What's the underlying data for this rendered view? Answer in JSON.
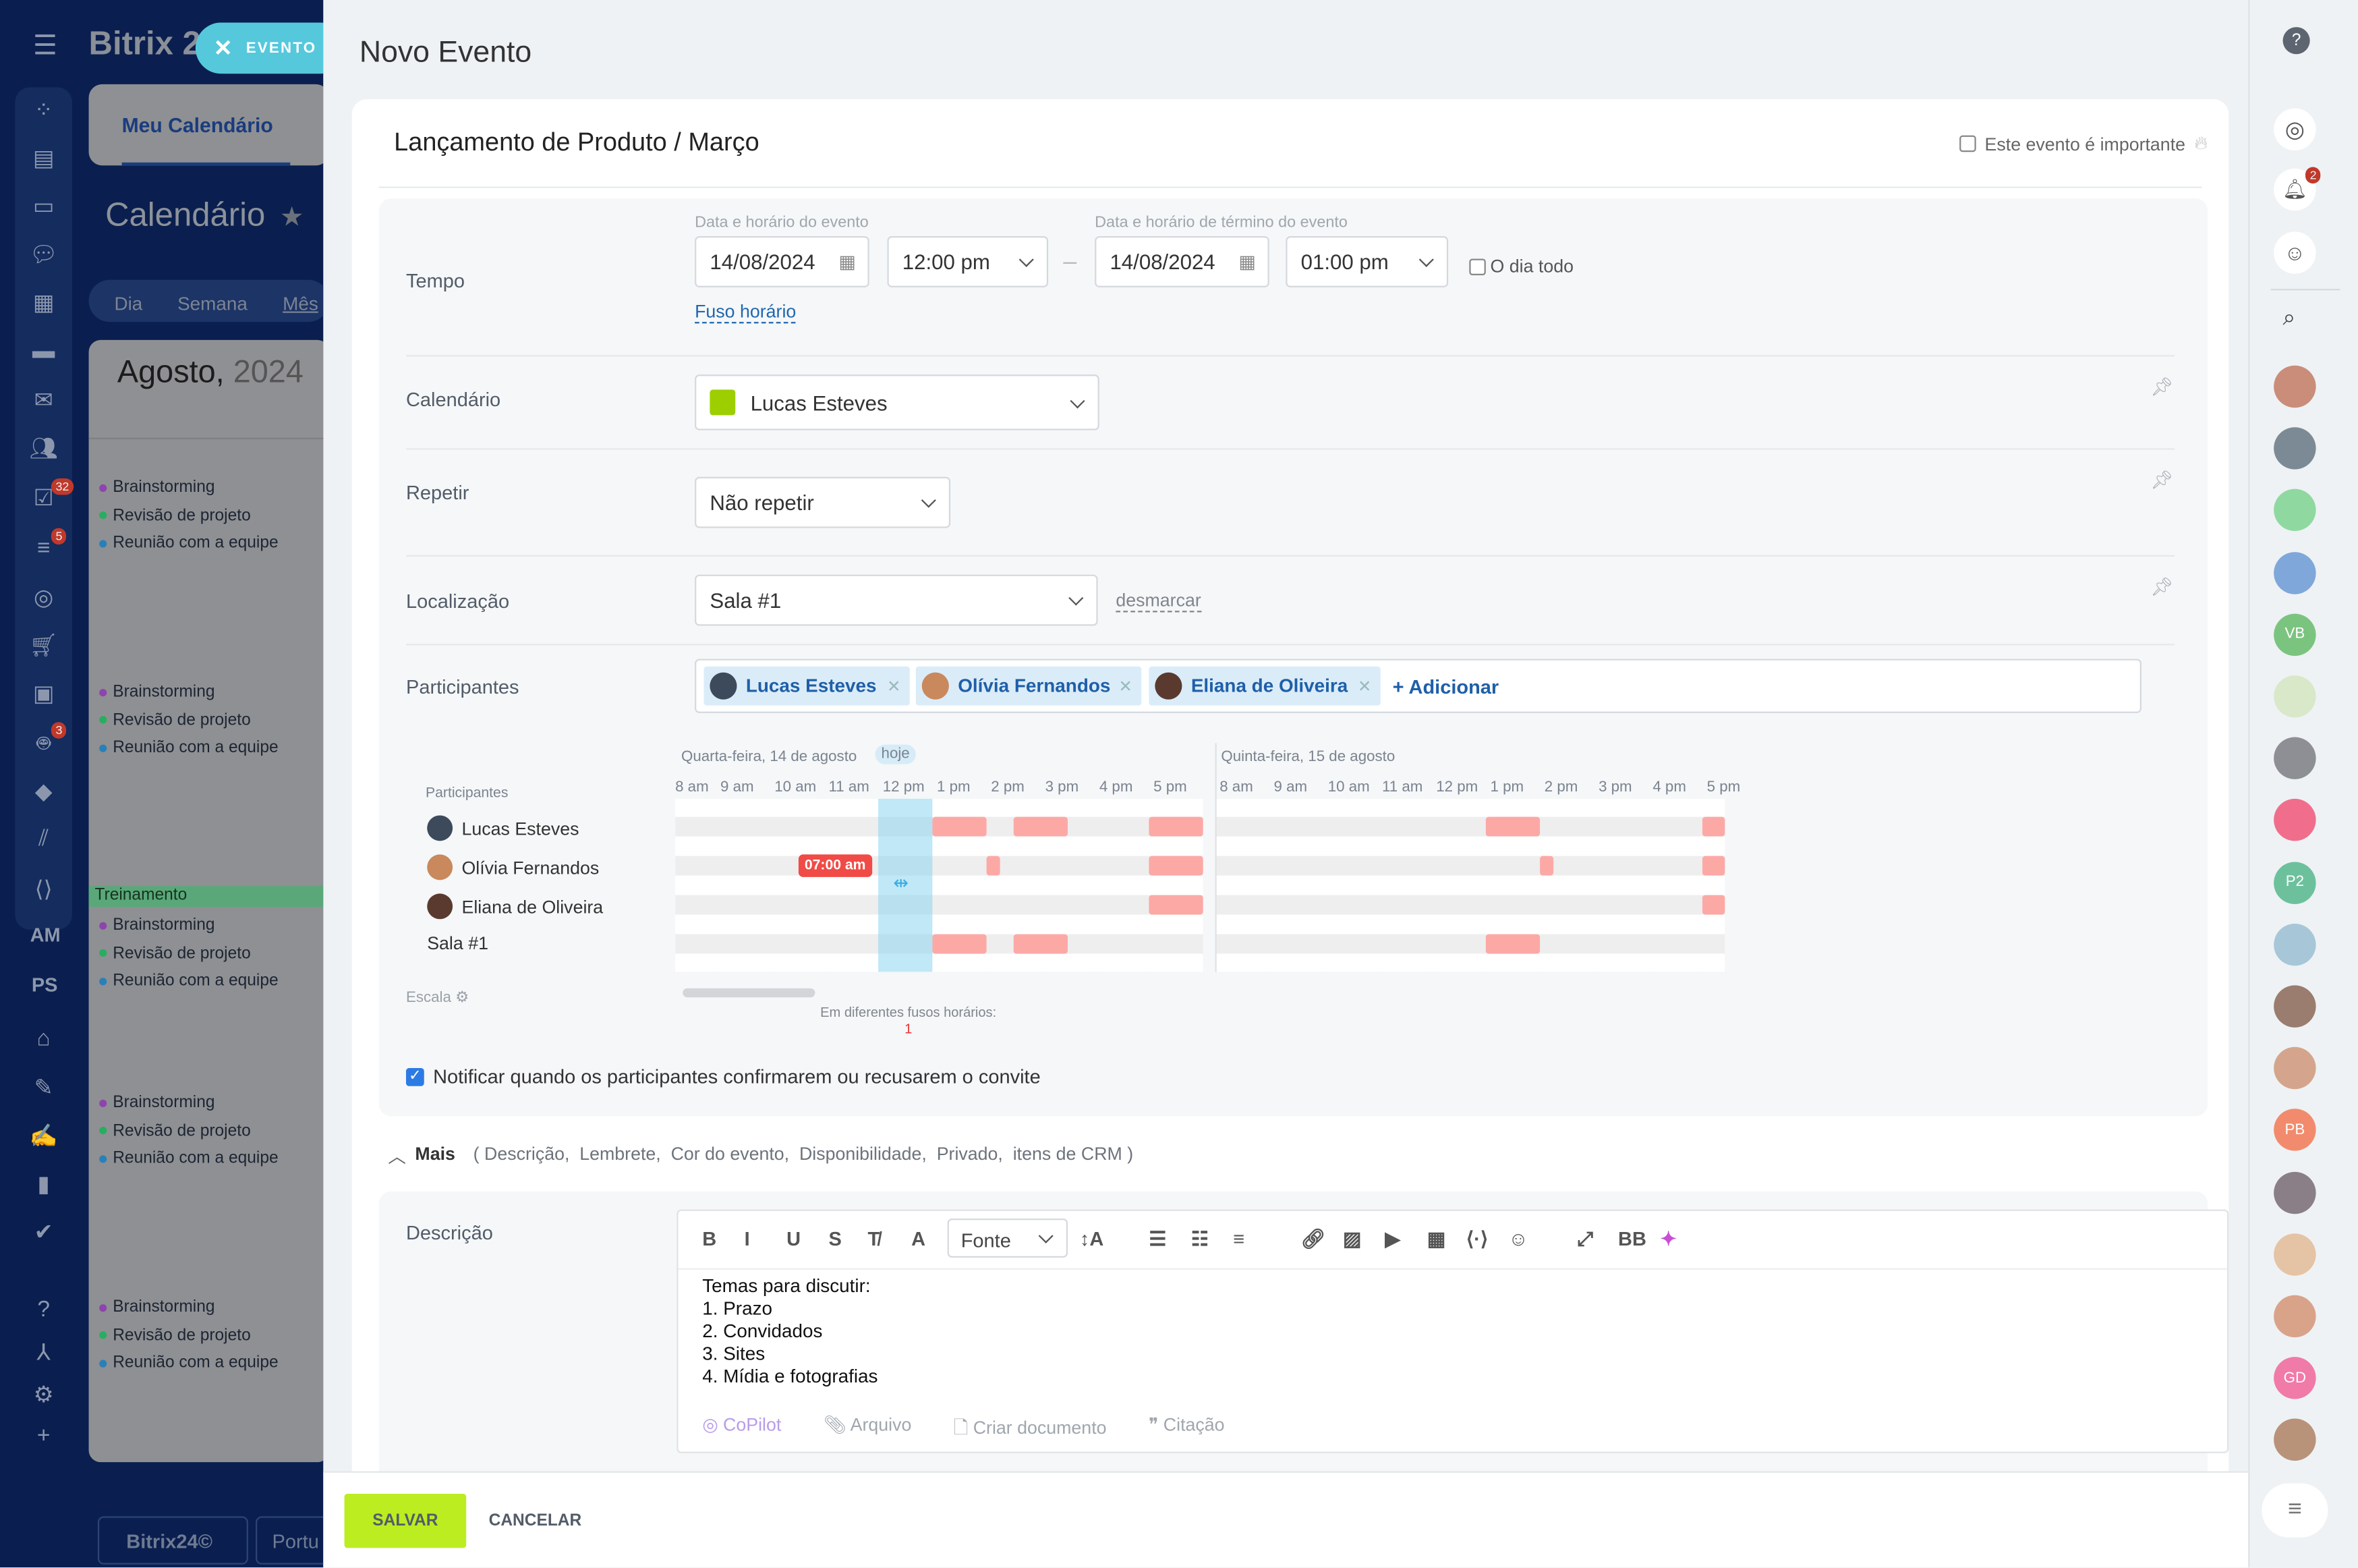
{
  "app": {
    "logo_text": "Bitrix 2",
    "close_tab_label": "EVENTO",
    "my_calendar_tab": "Meu Calendário",
    "page_title": "Calendário",
    "view_tabs": [
      "Dia",
      "Semana",
      "Mês"
    ],
    "month_label": "Agosto,",
    "year_label": "2024",
    "nav_badges": {
      "tasks": "32",
      "filters": "5",
      "bots": "3"
    },
    "nav_text_items": [
      "AM",
      "PS"
    ],
    "event_groups": [
      {
        "items": [
          {
            "label": "Brainstorming",
            "color": "#8e44ad"
          },
          {
            "label": "Revisão de projeto",
            "color": "#27ae60"
          },
          {
            "label": "Reunião com a equipe",
            "color": "#2980b9"
          }
        ]
      },
      {
        "items": [
          {
            "label": "Brainstorming",
            "color": "#8e44ad"
          },
          {
            "label": "Revisão de projeto",
            "color": "#27ae60"
          },
          {
            "label": "Reunião com a equipe",
            "color": "#2980b9"
          }
        ]
      },
      {
        "highlight": "Treinamento",
        "items": [
          {
            "label": "Brainstorming",
            "color": "#8e44ad"
          },
          {
            "label": "Revisão de projeto",
            "color": "#27ae60"
          },
          {
            "label": "Reunião com a equipe",
            "color": "#2980b9"
          }
        ]
      },
      {
        "items": [
          {
            "label": "Brainstorming",
            "color": "#8e44ad"
          },
          {
            "label": "Revisão de projeto",
            "color": "#27ae60"
          },
          {
            "label": "Reunião com a equipe",
            "color": "#2980b9"
          }
        ]
      },
      {
        "items": [
          {
            "label": "Brainstorming",
            "color": "#8e44ad"
          },
          {
            "label": "Revisão de projeto",
            "color": "#27ae60"
          },
          {
            "label": "Reunião com a equipe",
            "color": "#2980b9"
          }
        ]
      }
    ],
    "footer_logo": "Bitrix24©",
    "footer_lang": "Portu"
  },
  "form": {
    "title": "Novo Evento",
    "event_name": "Lançamento de Produto / Março",
    "important_label": "Este evento é importante",
    "important_checked": false,
    "time": {
      "label": "Tempo",
      "start_caption": "Data e horário do evento",
      "end_caption": "Data e horário de término do evento",
      "start_date": "14/08/2024",
      "start_time": "12:00 pm",
      "end_date": "14/08/2024",
      "end_time": "01:00 pm",
      "all_day_label": "O dia todo",
      "all_day_checked": false,
      "timezone_link": "Fuso horário"
    },
    "calendar": {
      "label": "Calendário",
      "value": "Lucas Esteves",
      "color": "#9dcf00"
    },
    "repeat": {
      "label": "Repetir",
      "value": "Não repetir"
    },
    "location": {
      "label": "Localização",
      "value": "Sala #1",
      "clear_link": "desmarcar"
    },
    "participants": {
      "label": "Participantes",
      "chips": [
        "Lucas Esteves",
        "Olívia Fernandos",
        "Eliana de Oliveira"
      ],
      "add_label": "+ Adicionar"
    },
    "planner": {
      "participants_header": "Participantes",
      "rows": [
        "Lucas Esteves",
        "Olívia Fernandos",
        "Eliana de Oliveira",
        "Sala #1"
      ],
      "days": [
        {
          "label": "Quarta-feira, 14 de agosto",
          "today_badge": "hoje",
          "hours": [
            "8 am",
            "9 am",
            "10 am",
            "11 am",
            "12 pm",
            "1 pm",
            "2 pm",
            "3 pm",
            "4 pm",
            "5 pm"
          ],
          "busy": [
            [
              [
                13,
                14
              ],
              [
                14.5,
                15.5
              ],
              [
                17,
                18
              ]
            ],
            [
              [
                14,
                14.25
              ],
              [
                17,
                18
              ]
            ],
            [
              [
                17,
                18
              ]
            ],
            [
              [
                13,
                14
              ],
              [
                14.5,
                15.5
              ]
            ]
          ]
        },
        {
          "label": "Quinta-feira, 15 de agosto",
          "hours": [
            "8 am",
            "9 am",
            "10 am",
            "11 am",
            "12 pm",
            "1 pm",
            "2 pm",
            "3 pm",
            "4 pm",
            "5 pm"
          ],
          "busy": [
            [
              [
                13,
                14
              ],
              [
                17,
                18
              ]
            ],
            [
              [
                14,
                14.25
              ],
              [
                17,
                18
              ]
            ],
            [
              [
                17,
                18
              ]
            ],
            [
              [
                13,
                14
              ]
            ]
          ]
        }
      ],
      "selection": [
        12,
        13
      ],
      "timezone_flag": "07:00 am",
      "scale_label": "Escala",
      "tz_note": "Em diferentes fusos horários:",
      "tz_count": "1"
    },
    "notify_label": "Notificar quando os participantes confirmarem ou recusarem o convite",
    "notify_checked": true,
    "more": {
      "label": "Mais",
      "items": "( Descrição,  Lembrete,  Cor do evento,  Disponibilidade,  Privado,  itens de CRM )"
    },
    "description": {
      "label": "Descrição",
      "font_select": "Fonte",
      "lines": [
        "Temas para discutir:",
        "1. Prazo",
        "2. Convidados",
        "3. Sites",
        "4. Mídia e fotografias"
      ],
      "bottom_actions": [
        "CoPilot",
        "Arquivo",
        "Criar documento",
        "Citação"
      ]
    },
    "save_label": "SALVAR",
    "cancel_label": "CANCELAR"
  },
  "rightbar": {
    "notification_count": "2",
    "avatars": [
      {
        "initials": "",
        "color": "#c98d7a"
      },
      {
        "initials": "",
        "color": "#7c8a95"
      },
      {
        "initials": "",
        "color": "#8fd9a0"
      },
      {
        "initials": "",
        "color": "#7fa7d9"
      },
      {
        "initials": "VB",
        "color": "#7bc47f"
      },
      {
        "initials": "",
        "color": "#d9e8c9"
      },
      {
        "initials": "",
        "color": "#8e8f95"
      },
      {
        "initials": "",
        "color": "#f06e8c"
      },
      {
        "initials": "P2",
        "color": "#6cc19c"
      },
      {
        "initials": "",
        "color": "#a7c7d9"
      },
      {
        "initials": "",
        "color": "#9a7d6e"
      },
      {
        "initials": "",
        "color": "#d4a58c"
      },
      {
        "initials": "PB",
        "color": "#f28b6d"
      },
      {
        "initials": "",
        "color": "#8a7f86"
      },
      {
        "initials": "",
        "color": "#e5c3a5"
      },
      {
        "initials": "",
        "color": "#d9a38a"
      },
      {
        "initials": "GD",
        "color": "#f07aa8"
      },
      {
        "initials": "",
        "color": "#b9927a"
      }
    ]
  }
}
